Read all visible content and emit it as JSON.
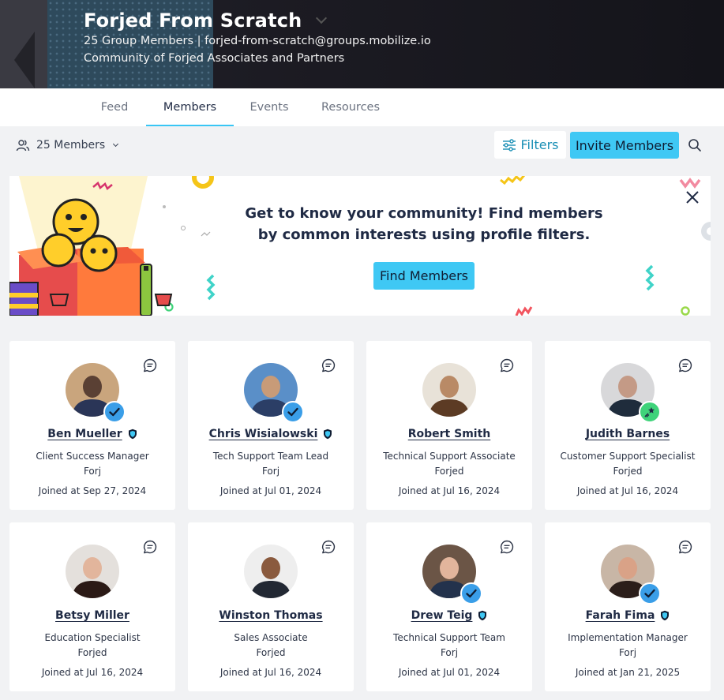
{
  "header": {
    "title": "Forjed From Scratch",
    "subtitle": "25 Group Members | forjed-from-scratch@groups.mobilize.io",
    "description": "Community of Forjed Associates and Partners"
  },
  "tabs": [
    {
      "label": "Feed",
      "active": false
    },
    {
      "label": "Members",
      "active": true
    },
    {
      "label": "Events",
      "active": false
    },
    {
      "label": "Resources",
      "active": false
    }
  ],
  "toolbar": {
    "members_label": "25 Members",
    "filters_label": "Filters",
    "invite_label": "Invite Members"
  },
  "banner": {
    "line1": "Get to know your community! Find members",
    "line2": "by common interests using profile filters.",
    "button_label": "Find Members"
  },
  "colors": {
    "accent": "#3fc8f4",
    "filters_text": "#1a8fb5",
    "badge_blue": "#3a9ee8",
    "badge_green": "#3fd37a",
    "tab_underline": "#39c6f5"
  },
  "members": [
    {
      "name": "Ben Mueller",
      "role": "Client Success Manager",
      "company": "Forj",
      "joined": "Joined at Sep 27, 2024",
      "badge": "check",
      "shield": true
    },
    {
      "name": "Chris Wisialowski",
      "role": "Tech Support Team Lead",
      "company": "Forj",
      "joined": "Joined at Jul 01, 2024",
      "badge": "check",
      "shield": true
    },
    {
      "name": "Robert Smith",
      "role": "Technical Support Associate",
      "company": "Forjed",
      "joined": "Joined at Jul 16, 2024",
      "badge": "none",
      "shield": false
    },
    {
      "name": "Judith Barnes",
      "role": "Customer Support Specialist",
      "company": "Forjed",
      "joined": "Joined at Jul 16, 2024",
      "badge": "star",
      "shield": false
    },
    {
      "name": "Betsy Miller",
      "role": "Education Specialist",
      "company": "Forjed",
      "joined": "Joined at Jul 16, 2024",
      "badge": "none",
      "shield": false
    },
    {
      "name": "Winston Thomas",
      "role": "Sales Associate",
      "company": "Forjed",
      "joined": "Joined at Jul 16, 2024",
      "badge": "none",
      "shield": false
    },
    {
      "name": "Drew Teig",
      "role": "Technical Support Team",
      "company": "Forj",
      "joined": "Joined at Jul 01, 2024",
      "badge": "check",
      "shield": true
    },
    {
      "name": "Farah Fima",
      "role": "Implementation Manager",
      "company": "Forj",
      "joined": "Joined at Jan 21, 2025",
      "badge": "check",
      "shield": true
    }
  ]
}
